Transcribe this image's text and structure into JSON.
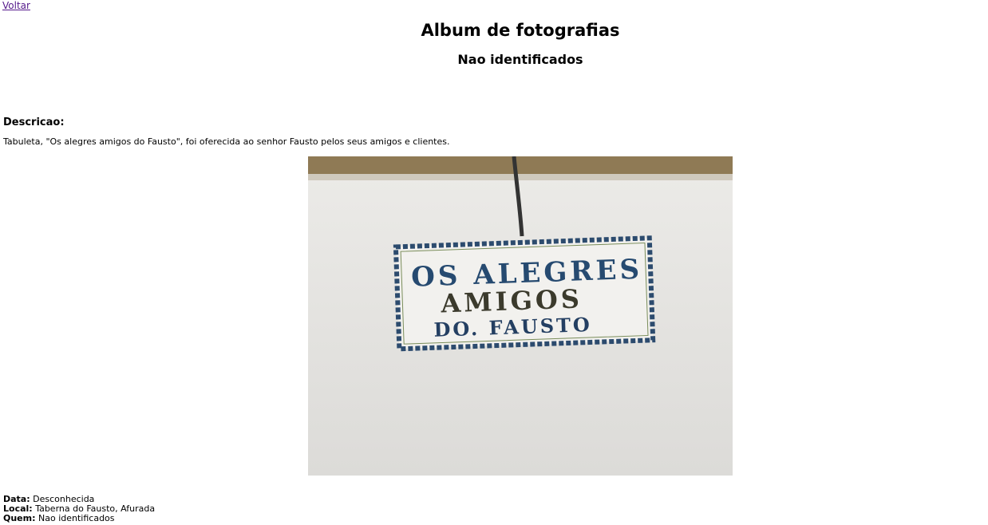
{
  "nav": {
    "back_label": "Voltar"
  },
  "header": {
    "title": "Album de fotografias",
    "subtitle": "Nao identificados"
  },
  "description": {
    "heading": "Descricao:",
    "text": "Tabuleta, \"Os alegres amigos do Fausto\", foi oferecida ao senhor Fausto pelos seus amigos e clientes."
  },
  "photo": {
    "sign_line1": "OS ALEGRES",
    "sign_line2": "AMIGOS",
    "sign_line3": "DO. FAUSTO"
  },
  "meta": {
    "date_label": "Data:",
    "date_value": "Desconhecida",
    "place_label": "Local:",
    "place_value": "Taberna do Fausto, Afurada",
    "who_label": "Quem:",
    "who_value": "Nao identificados"
  }
}
